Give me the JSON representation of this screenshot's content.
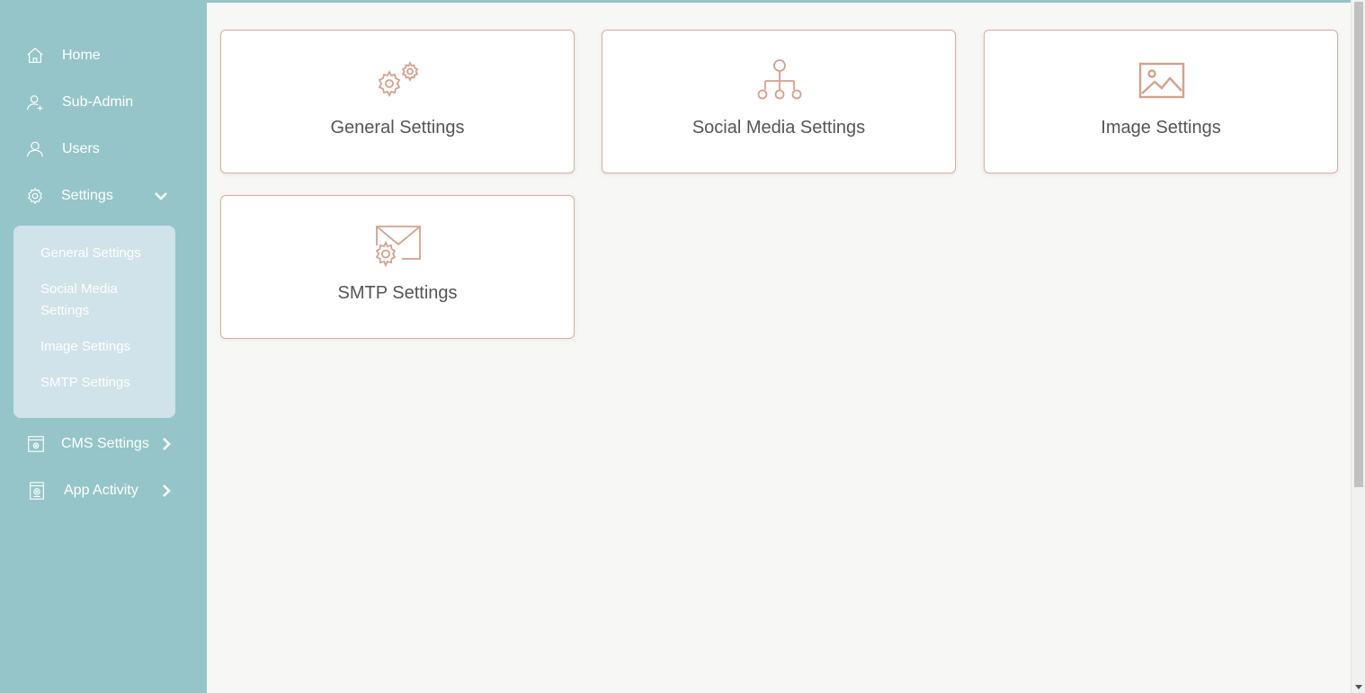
{
  "sidebar": {
    "items": [
      {
        "label": "Home",
        "icon": "home-icon"
      },
      {
        "label": "Sub-Admin",
        "icon": "add-user-icon"
      },
      {
        "label": "Users",
        "icon": "user-icon"
      },
      {
        "label": "Settings",
        "icon": "gear-icon",
        "expanded": true
      },
      {
        "label": "CMS Settings",
        "icon": "cms-icon"
      },
      {
        "label": "App Activity",
        "icon": "activity-icon"
      }
    ],
    "settings_submenu": [
      {
        "label": "General Settings"
      },
      {
        "label": "Social Media Settings"
      },
      {
        "label": "Image Settings"
      },
      {
        "label": "SMTP Settings"
      }
    ]
  },
  "cards": [
    {
      "title": "General Settings",
      "icon": "gears-icon"
    },
    {
      "title": "Social Media Settings",
      "icon": "network-icon"
    },
    {
      "title": "Image Settings",
      "icon": "image-icon"
    },
    {
      "title": "SMTP Settings",
      "icon": "mail-gear-icon"
    }
  ],
  "colors": {
    "sidebar": "#95c5c8",
    "submenu": "#d0e2ea",
    "card_border": "#d9aea1",
    "icon": "#d4a08e",
    "background": "#f7f7f5"
  }
}
